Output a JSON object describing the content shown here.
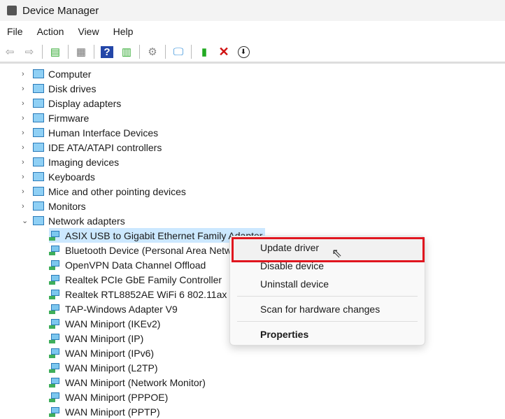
{
  "window": {
    "title": "Device Manager"
  },
  "menubar": [
    "File",
    "Action",
    "View",
    "Help"
  ],
  "toolbar": [
    "back-icon",
    "forward-icon",
    "show-hide-console-tree-icon",
    "properties-sheet-icon",
    "help-icon",
    "action-pane-icon",
    "update-driver-software-icon",
    "scan-hardware-icon",
    "enable-device-icon",
    "uninstall-icon",
    "disable-device-icon"
  ],
  "tree": {
    "categories": [
      "Computer",
      "Disk drives",
      "Display adapters",
      "Firmware",
      "Human Interface Devices",
      "IDE ATA/ATAPI controllers",
      "Imaging devices",
      "Keyboards",
      "Mice and other pointing devices",
      "Monitors",
      "Network adapters"
    ],
    "network_adapters": [
      "ASIX USB to Gigabit Ethernet Family Adapter",
      "Bluetooth Device (Personal Area Netw",
      "OpenVPN Data Channel Offload",
      "Realtek PCIe GbE Family Controller",
      "Realtek RTL8852AE WiFi 6 802.11ax PC",
      "TAP-Windows Adapter V9",
      "WAN Miniport (IKEv2)",
      "WAN Miniport (IP)",
      "WAN Miniport (IPv6)",
      "WAN Miniport (L2TP)",
      "WAN Miniport (Network Monitor)",
      "WAN Miniport (PPPOE)",
      "WAN Miniport (PPTP)"
    ]
  },
  "context_menu": {
    "update": "Update driver",
    "disable": "Disable device",
    "uninstall": "Uninstall device",
    "scan": "Scan for hardware changes",
    "properties": "Properties"
  }
}
